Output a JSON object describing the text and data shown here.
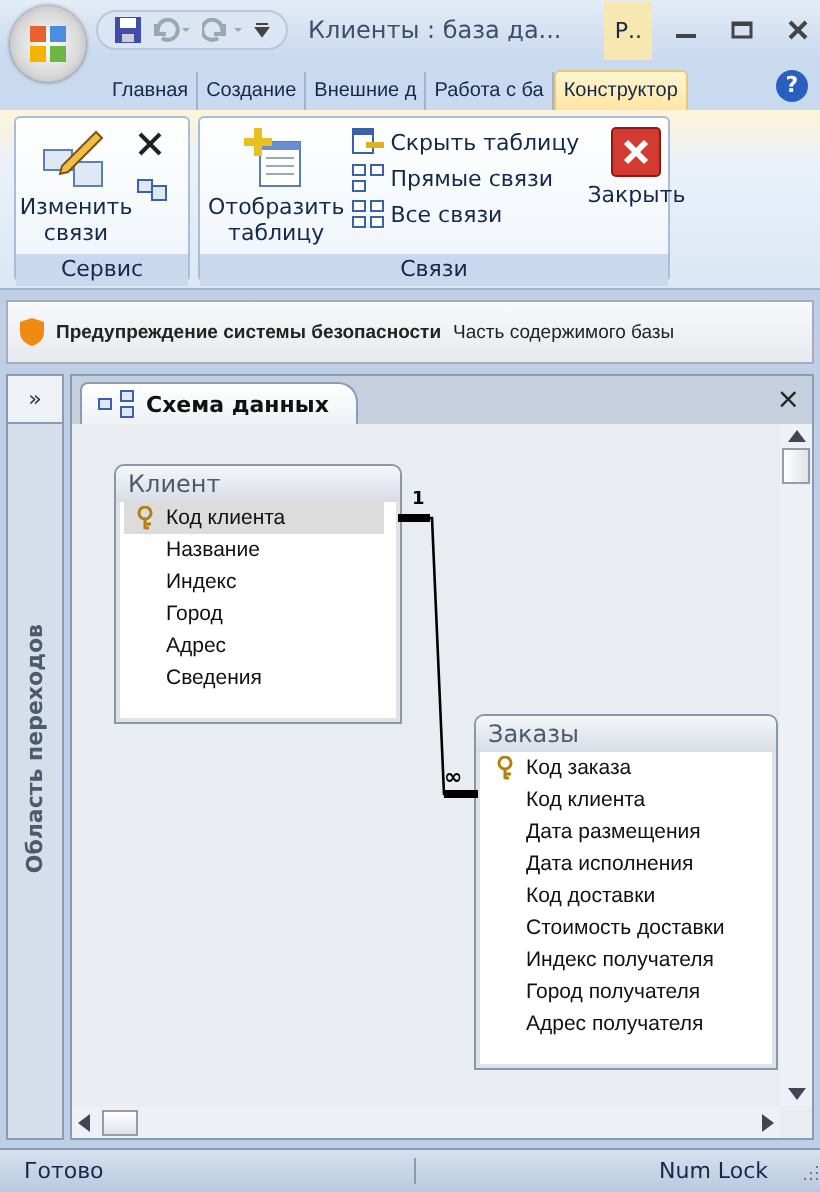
{
  "window": {
    "title": "Клиенты : база да...",
    "context_tab": "Р..",
    "help": "?"
  },
  "tabs": [
    {
      "label": "Главная",
      "selected": false
    },
    {
      "label": "Создание",
      "selected": false
    },
    {
      "label": "Внешние д",
      "selected": false
    },
    {
      "label": "Работа с ба",
      "selected": false
    },
    {
      "label": "Конструктор",
      "selected": true
    }
  ],
  "ribbon": {
    "groups": [
      {
        "label": "Сервис",
        "edit_button": "Изменить связи"
      },
      {
        "label": "Связи",
        "show_table": "Отобразить таблицу",
        "small_buttons": [
          {
            "label": "Скрыть таблицу",
            "kind": "hide"
          },
          {
            "label": "Прямые связи",
            "kind": "direct"
          },
          {
            "label": "Все связи",
            "kind": "all"
          }
        ],
        "close_button": "Закрыть"
      }
    ]
  },
  "security_bar": {
    "title": "Предупреждение системы безопасности",
    "message": "Часть содержимого базы"
  },
  "navigation_pane": {
    "toggle": "»",
    "label": "Область переходов"
  },
  "document_tab": {
    "label": "Схема данных",
    "close": "×"
  },
  "tables": [
    {
      "name": "Клиент",
      "fields": [
        {
          "name": "Код клиента",
          "key": true,
          "selected": true
        },
        {
          "name": "Название",
          "key": false,
          "selected": false
        },
        {
          "name": "Индекс",
          "key": false,
          "selected": false
        },
        {
          "name": "Город",
          "key": false,
          "selected": false
        },
        {
          "name": "Адрес",
          "key": false,
          "selected": false
        },
        {
          "name": "Сведения",
          "key": false,
          "selected": false
        }
      ]
    },
    {
      "name": "Заказы",
      "fields": [
        {
          "name": "Код заказа",
          "key": true,
          "selected": false
        },
        {
          "name": "Код клиента",
          "key": false,
          "selected": false
        },
        {
          "name": "Дата размещения",
          "key": false,
          "selected": false
        },
        {
          "name": "Дата исполнения",
          "key": false,
          "selected": false
        },
        {
          "name": "Код доставки",
          "key": false,
          "selected": false
        },
        {
          "name": "Стоимость доставки",
          "key": false,
          "selected": false
        },
        {
          "name": "Индекс получателя",
          "key": false,
          "selected": false
        },
        {
          "name": "Город получателя",
          "key": false,
          "selected": false
        },
        {
          "name": "Адрес получателя",
          "key": false,
          "selected": false
        }
      ]
    }
  ],
  "relationship": {
    "one_label": "1",
    "many_label": "∞"
  },
  "status_bar": {
    "left": "Готово",
    "right": "Num Lock"
  }
}
